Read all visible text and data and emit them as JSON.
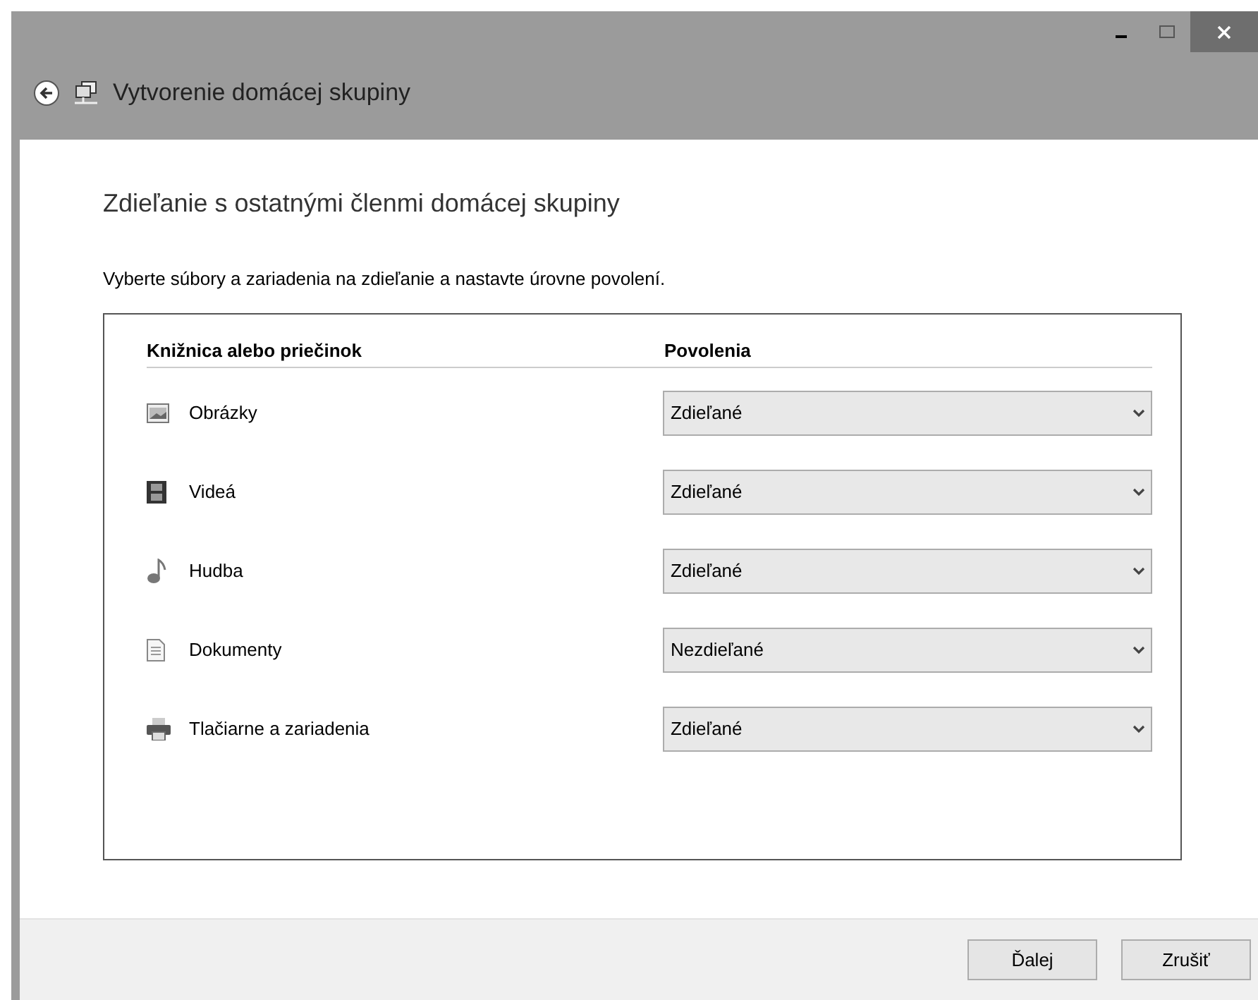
{
  "window": {
    "title": "Vytvorenie domácej skupiny"
  },
  "heading": "Zdieľanie s ostatnými členmi domácej skupiny",
  "instruction": "Vyberte súbory a zariadenia na zdieľanie a nastavte úrovne povolení.",
  "table": {
    "columns": [
      "Knižnica alebo priečinok",
      "Povolenia"
    ],
    "rows": [
      {
        "kind": "pictures",
        "name": "Obrázky",
        "permission": "Zdieľané"
      },
      {
        "kind": "videos",
        "name": "Videá",
        "permission": "Zdieľané"
      },
      {
        "kind": "music",
        "name": "Hudba",
        "permission": "Zdieľané"
      },
      {
        "kind": "documents",
        "name": "Dokumenty",
        "permission": "Nezdieľané"
      },
      {
        "kind": "printers",
        "name": "Tlačiarne a zariadenia",
        "permission": "Zdieľané"
      }
    ]
  },
  "buttons": [
    "Ďalej",
    "Zrušiť"
  ]
}
